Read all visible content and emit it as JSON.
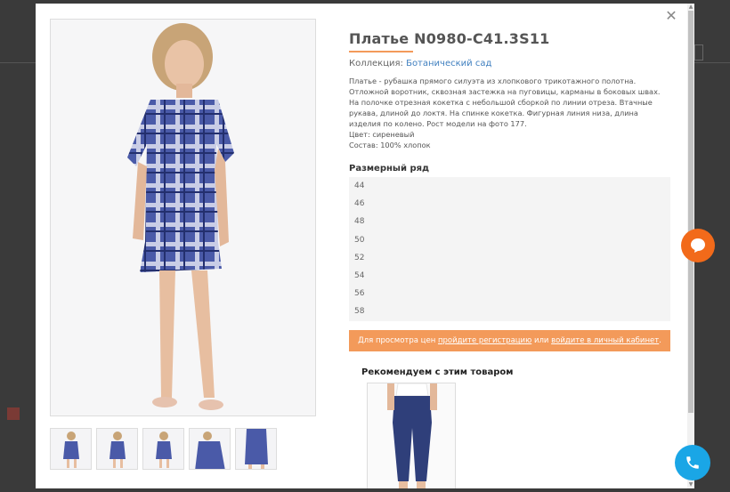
{
  "product": {
    "title": "Платье N0980-C41.3S11",
    "collection_label": "Коллекция:",
    "collection_link": "Ботанический сад",
    "description": "Платье - рубашка прямого силуэта из хлопкового трикотажного полотна. Отложной воротник, сквозная застежка на пуговицы, карманы в боковых швах. На полочке отрезная кокетка с небольшой сборкой по линии отреза. Втачные рукава, длиной до локтя. На спинке кокетка. Фигурная линия низа, длина изделия по колено. Рост модели на фото 177.",
    "color": "Цвет: сиреневый",
    "composition": "Состав: 100% хлопок"
  },
  "sizes": {
    "title": "Размерный ряд",
    "items": [
      "44",
      "46",
      "48",
      "50",
      "52",
      "54",
      "56",
      "58"
    ]
  },
  "promo": {
    "prefix": "Для просмотра цен",
    "link1": "пройдите регистрацию",
    "middle": "или",
    "link2": "войдите в личный кабинет",
    "suffix": "."
  },
  "recommend": {
    "title": "Рекомендуем с этим товаром"
  },
  "icons": {
    "close": "close-icon",
    "chat": "chat-icon",
    "phone": "phone-icon"
  },
  "colors": {
    "accent": "#f39a5a",
    "link": "#3f7fbf",
    "chat": "#f26a1a",
    "call": "#1aa6e6",
    "dress_blue": "#3f4f9e"
  }
}
